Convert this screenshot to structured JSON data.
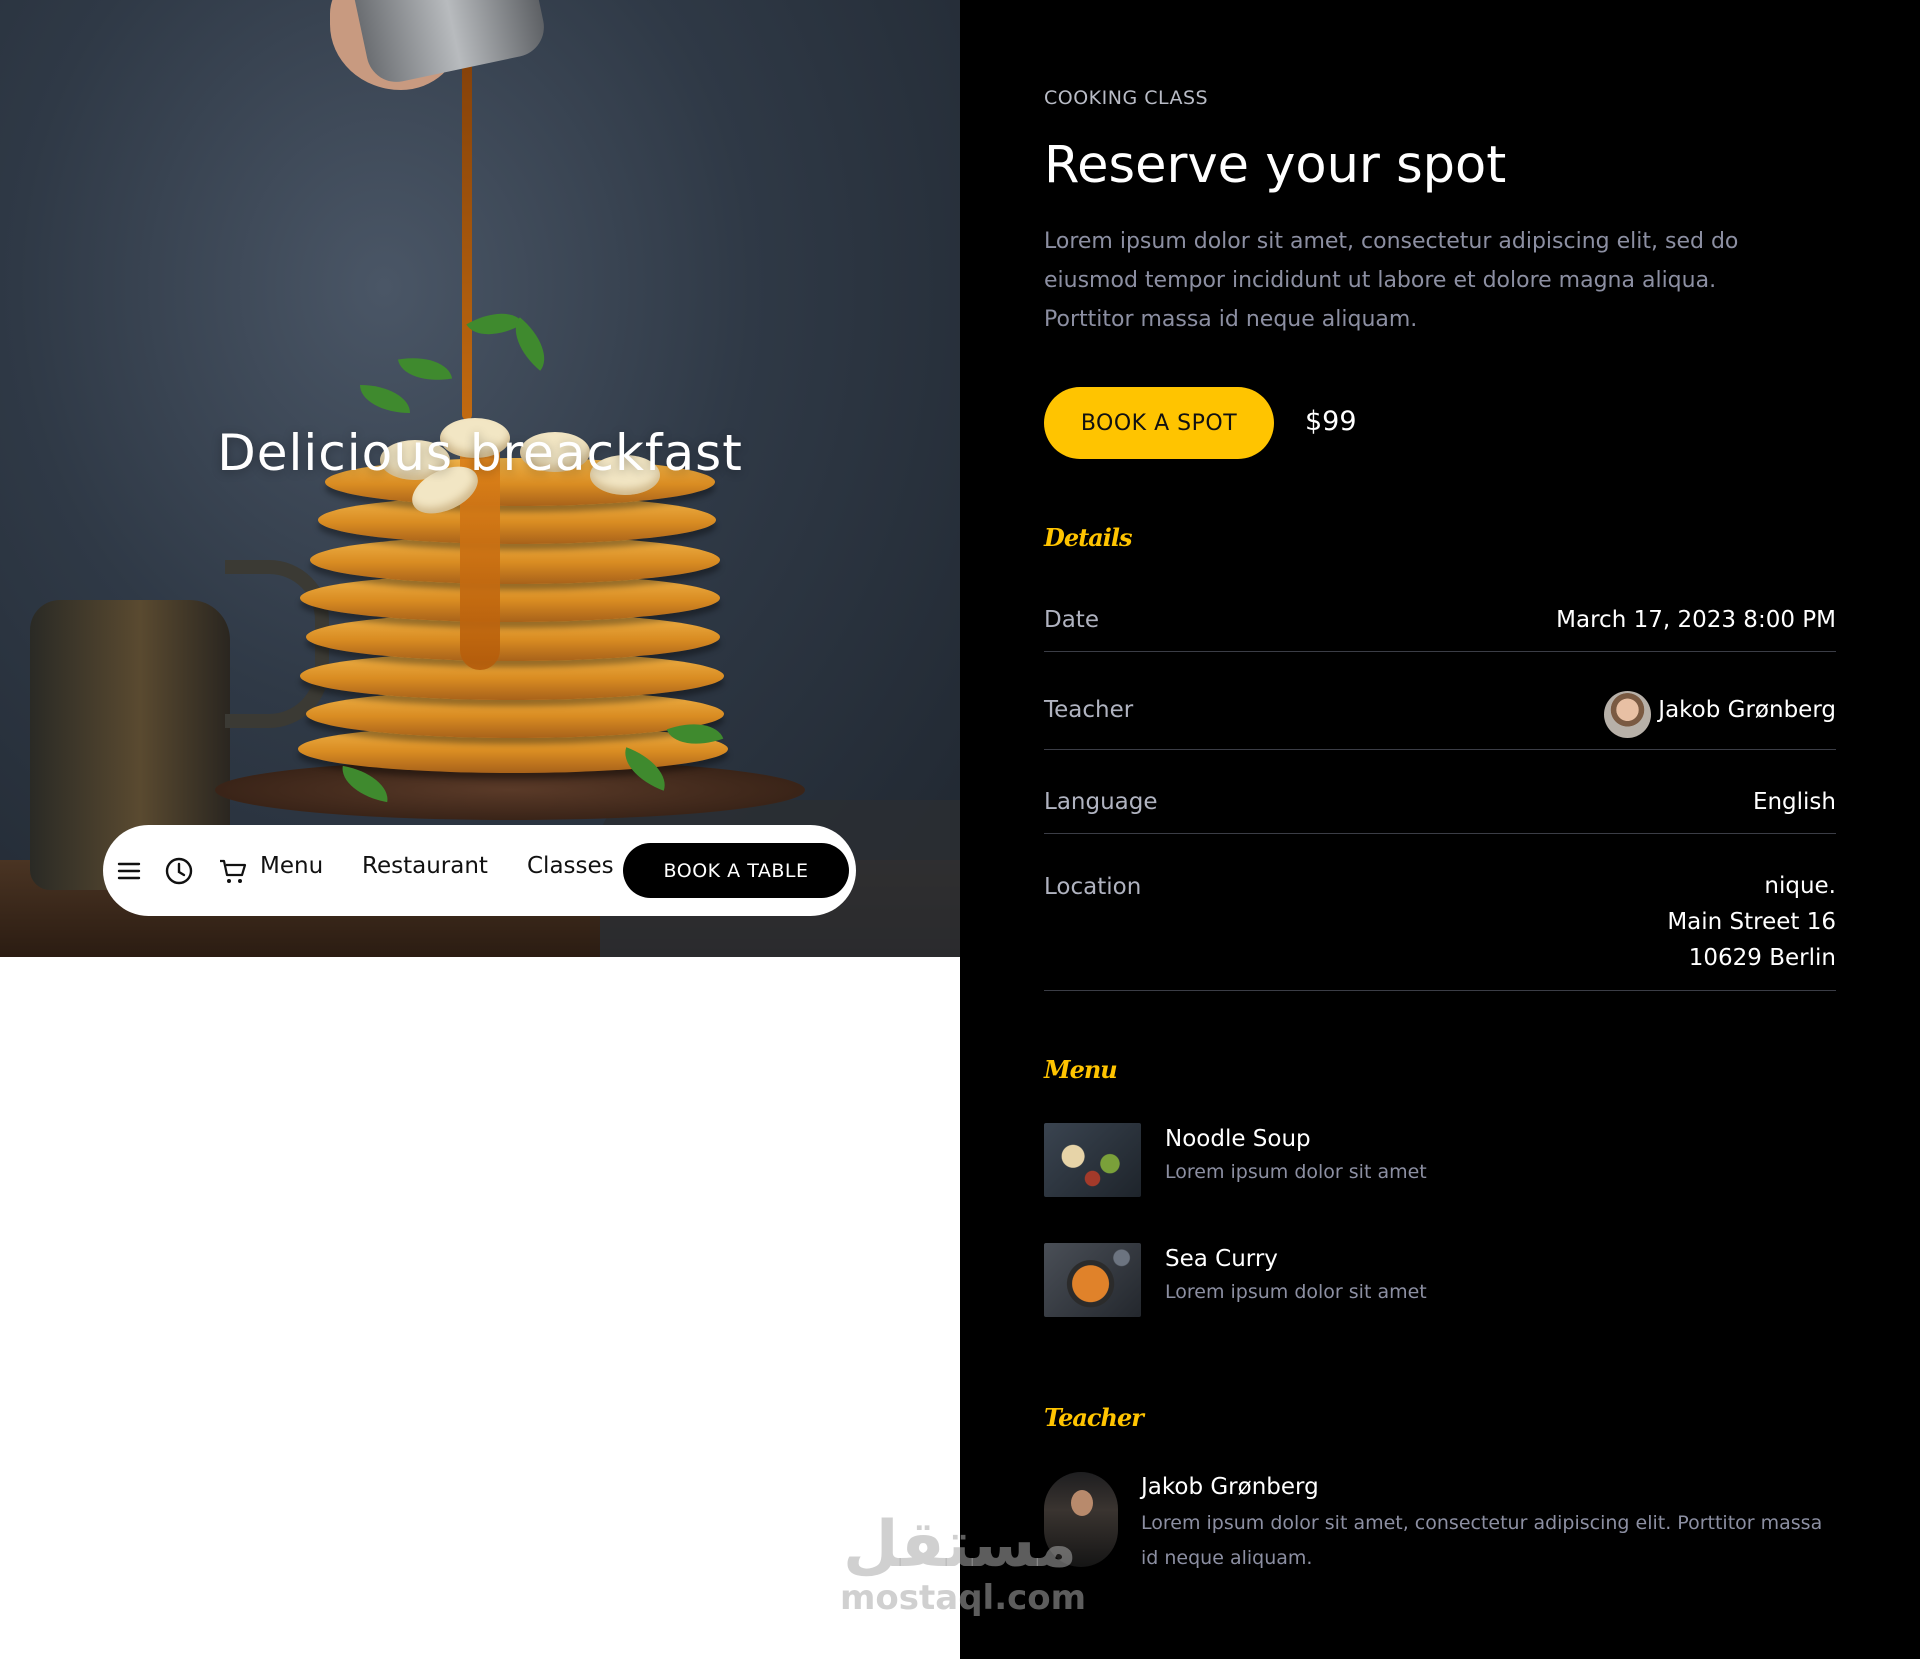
{
  "hero": {
    "title": "Delicious breackfast"
  },
  "nav": {
    "icons": [
      "hamburger-menu-icon",
      "clock-icon",
      "cart-icon"
    ],
    "links": [
      "Menu",
      "Restaurant",
      "Classes"
    ],
    "cta": "BOOK A TABLE"
  },
  "panel": {
    "eyebrow": "COOKING CLASS",
    "title": "Reserve your spot",
    "intro": "Lorem ipsum dolor sit amet, consectetur adipiscing elit, sed do eiusmod tempor incididunt ut labore et dolore magna aliqua. Porttitor massa id neque aliquam.",
    "book_label": "BOOK A SPOT",
    "price": "$99",
    "details_heading": "Details",
    "details": {
      "date_label": "Date",
      "date_value": "March 17, 2023 8:00 PM",
      "teacher_label": "Teacher",
      "teacher_value": "Jakob Grønberg",
      "language_label": "Language",
      "language_value": "English",
      "location_label": "Location",
      "location_lines": [
        "nique.",
        "Main Street 16",
        "10629 Berlin"
      ]
    },
    "menu_heading": "Menu",
    "menu_items": [
      {
        "name": "Noodle Soup",
        "desc": "Lorem ipsum dolor sit amet"
      },
      {
        "name": "Sea Curry",
        "desc": "Lorem ipsum dolor sit amet"
      }
    ],
    "teacher_heading": "Teacher",
    "teacher": {
      "name": "Jakob Grønberg",
      "bio": "Lorem ipsum dolor sit amet, consectetur adipiscing elit. Porttitor massa id neque aliquam."
    }
  },
  "watermark": {
    "arabic": "مستقل",
    "latin": "mostaql.com"
  },
  "colors": {
    "accent": "#ffc400",
    "panel_bg": "#000000",
    "muted_text": "#8c8fa2"
  }
}
